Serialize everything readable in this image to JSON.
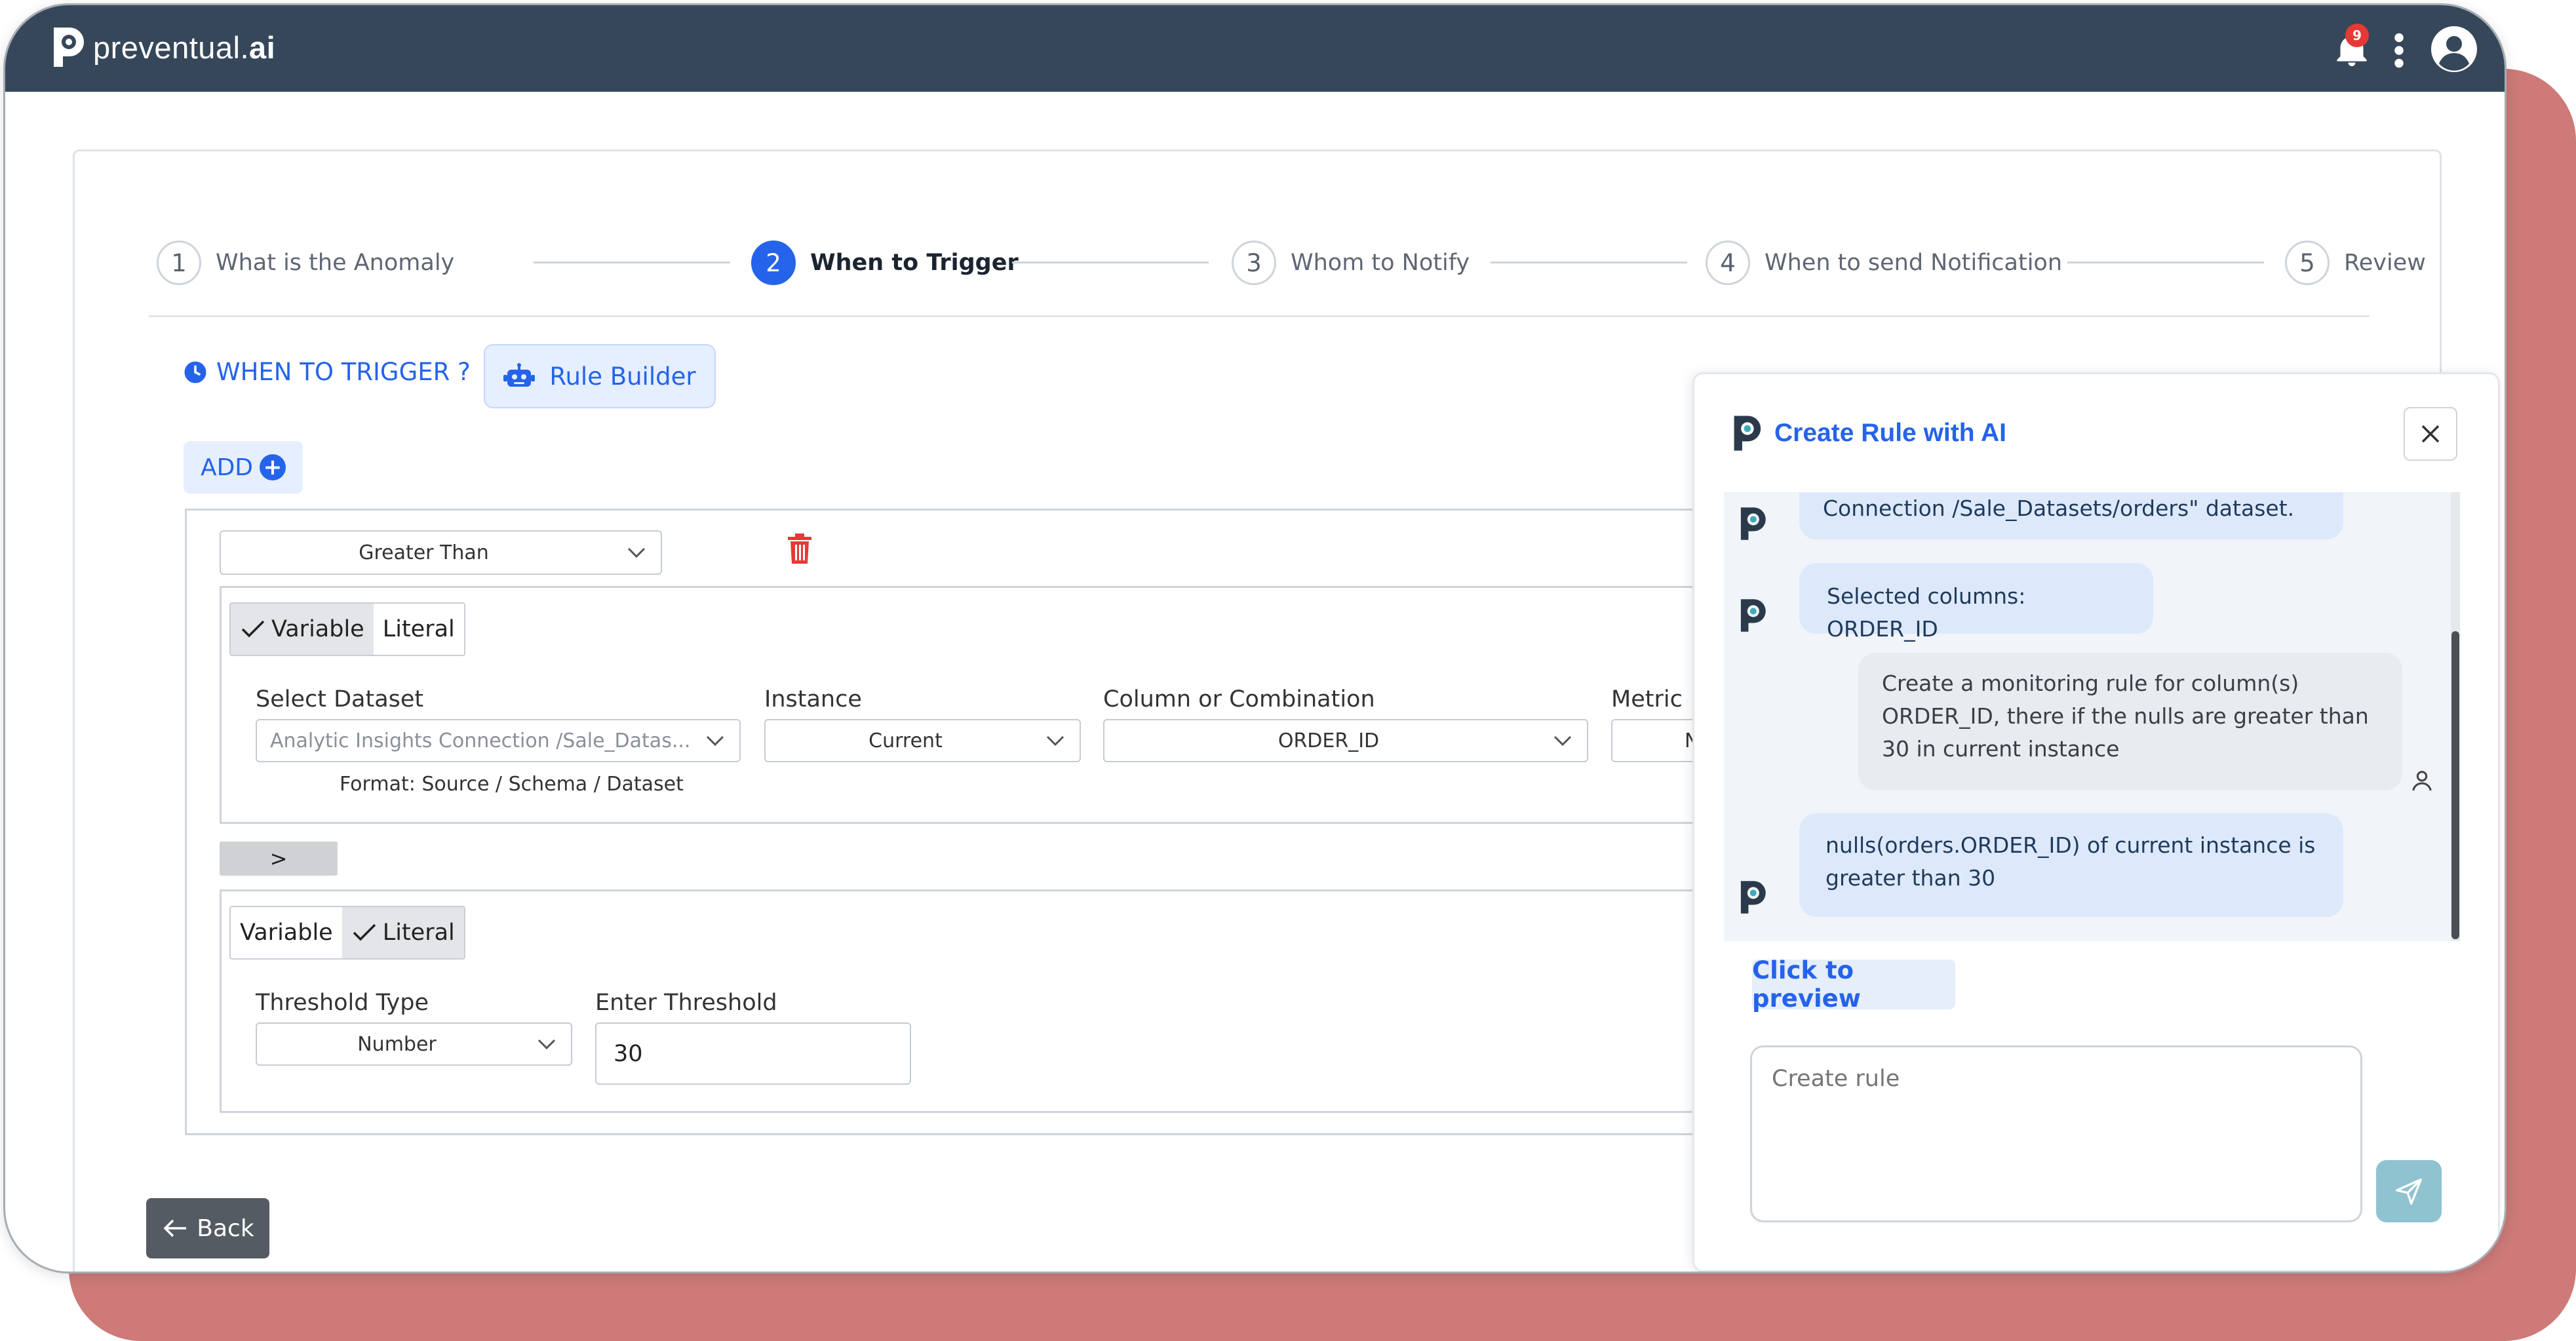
{
  "colors": {
    "header_bg": "#36475a",
    "frame_bg": "#cd7a78",
    "accent": "#2563eb"
  },
  "header": {
    "brand_regular": "preventual.",
    "brand_bold": "ai",
    "notification_count": "9"
  },
  "stepper": [
    {
      "num": "1",
      "label": "What is the Anomaly"
    },
    {
      "num": "2",
      "label": "When to Trigger"
    },
    {
      "num": "3",
      "label": "Whom to Notify"
    },
    {
      "num": "4",
      "label": "When to send Notification"
    },
    {
      "num": "5",
      "label": "Review"
    }
  ],
  "trigger": {
    "heading": "WHEN TO TRIGGER ?",
    "rule_builder": "Rule Builder",
    "add": "ADD"
  },
  "condition": {
    "operator": "Greater Than",
    "left": {
      "variable": "Variable",
      "literal": "Literal",
      "dataset_label": "Select Dataset",
      "dataset_value": "Analytic Insights Connection /Sale_Datas...",
      "dataset_hint": "Format: Source / Schema / Dataset",
      "instance_label": "Instance",
      "instance_value": "Current",
      "column_label": "Column or Combination",
      "column_value": "ORDER_ID",
      "metric_label": "Metric",
      "metric_value": "N"
    },
    "gt": ">",
    "right": {
      "variable": "Variable",
      "literal": "Literal",
      "threshold_type_label": "Threshold Type",
      "threshold_type_value": "Number",
      "threshold_label": "Enter Threshold",
      "threshold_value": "30"
    }
  },
  "back": "Back",
  "ai": {
    "title": "Create Rule with AI",
    "messages": [
      "Connection /Sale_Datasets/orders\" dataset.",
      "Selected columns: ORDER_ID",
      "Create a monitoring rule for column(s) ORDER_ID, there if the nulls are greater than 30 in current instance",
      "nulls(orders.ORDER_ID) of current instance is greater than 30"
    ],
    "preview": "Click to preview",
    "placeholder": "Create rule"
  }
}
